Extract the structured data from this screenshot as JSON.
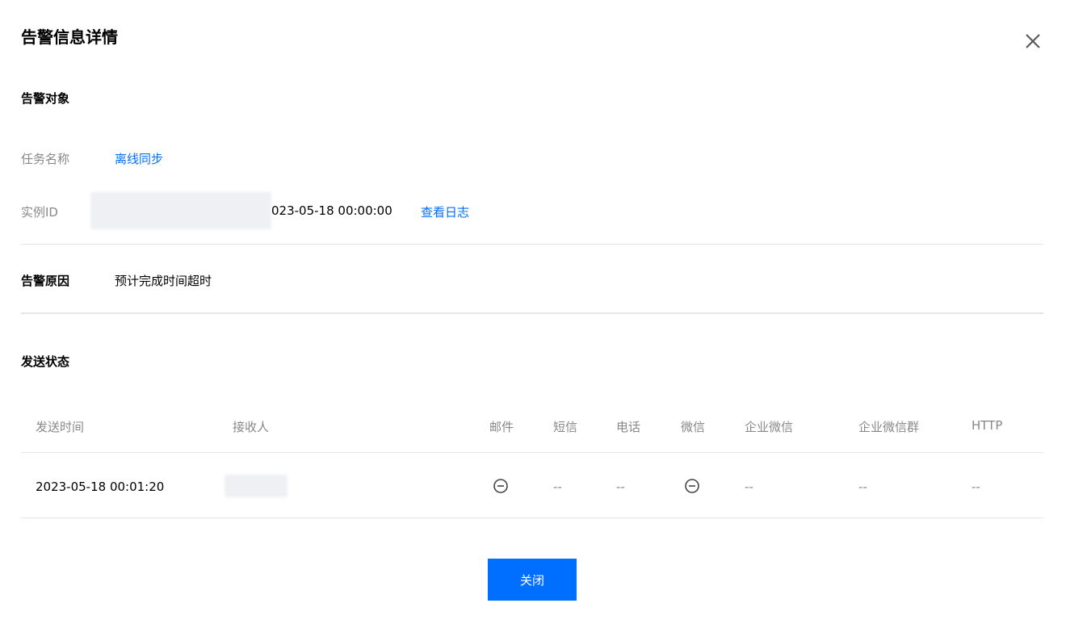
{
  "dialog": {
    "title": "告警信息详情"
  },
  "alarm_object": {
    "heading": "告警对象",
    "task_name_label": "任务名称",
    "task_name_value": "离线同步",
    "instance_id_label": "实例ID",
    "instance_id_visible": "023-05-18 00:00:00",
    "view_log_link": "查看日志"
  },
  "alarm_reason": {
    "label": "告警原因",
    "value": "预计完成时间超时"
  },
  "send_status": {
    "heading": "发送状态",
    "columns": [
      "发送时间",
      "接收人",
      "邮件",
      "短信",
      "电话",
      "微信",
      "企业微信",
      "企业微信群",
      "HTTP"
    ],
    "rows": [
      {
        "send_time": "2023-05-18 00:01:20",
        "email": "minus-circle-icon",
        "sms": "--",
        "phone": "--",
        "wechat": "minus-circle-icon",
        "wecom": "--",
        "wecom_group": "--",
        "http": "--"
      }
    ]
  },
  "footer": {
    "close_label": "关闭"
  },
  "colors": {
    "accent": "#006eff",
    "label_gray": "#888888",
    "divider": "#e5e5e5"
  }
}
